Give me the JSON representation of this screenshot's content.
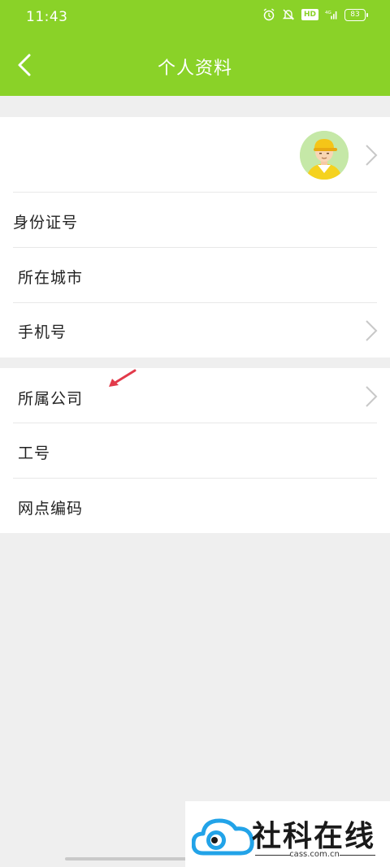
{
  "status_bar": {
    "time": "11:43",
    "network": "4G",
    "hd": "HD",
    "battery": "83"
  },
  "nav": {
    "title": "个人资料"
  },
  "group1": {
    "items": [
      {
        "label": "身份证号"
      },
      {
        "label": "所在城市"
      },
      {
        "label": "手机号"
      }
    ]
  },
  "group2": {
    "items": [
      {
        "label": "所属公司"
      },
      {
        "label": "工号"
      },
      {
        "label": "网点编码"
      }
    ]
  },
  "watermark": {
    "name": "社科在线",
    "url": "cass.com.cn"
  },
  "colors": {
    "accent": "#8ad228",
    "background": "#efefef",
    "arrow": "#e23a4a"
  }
}
